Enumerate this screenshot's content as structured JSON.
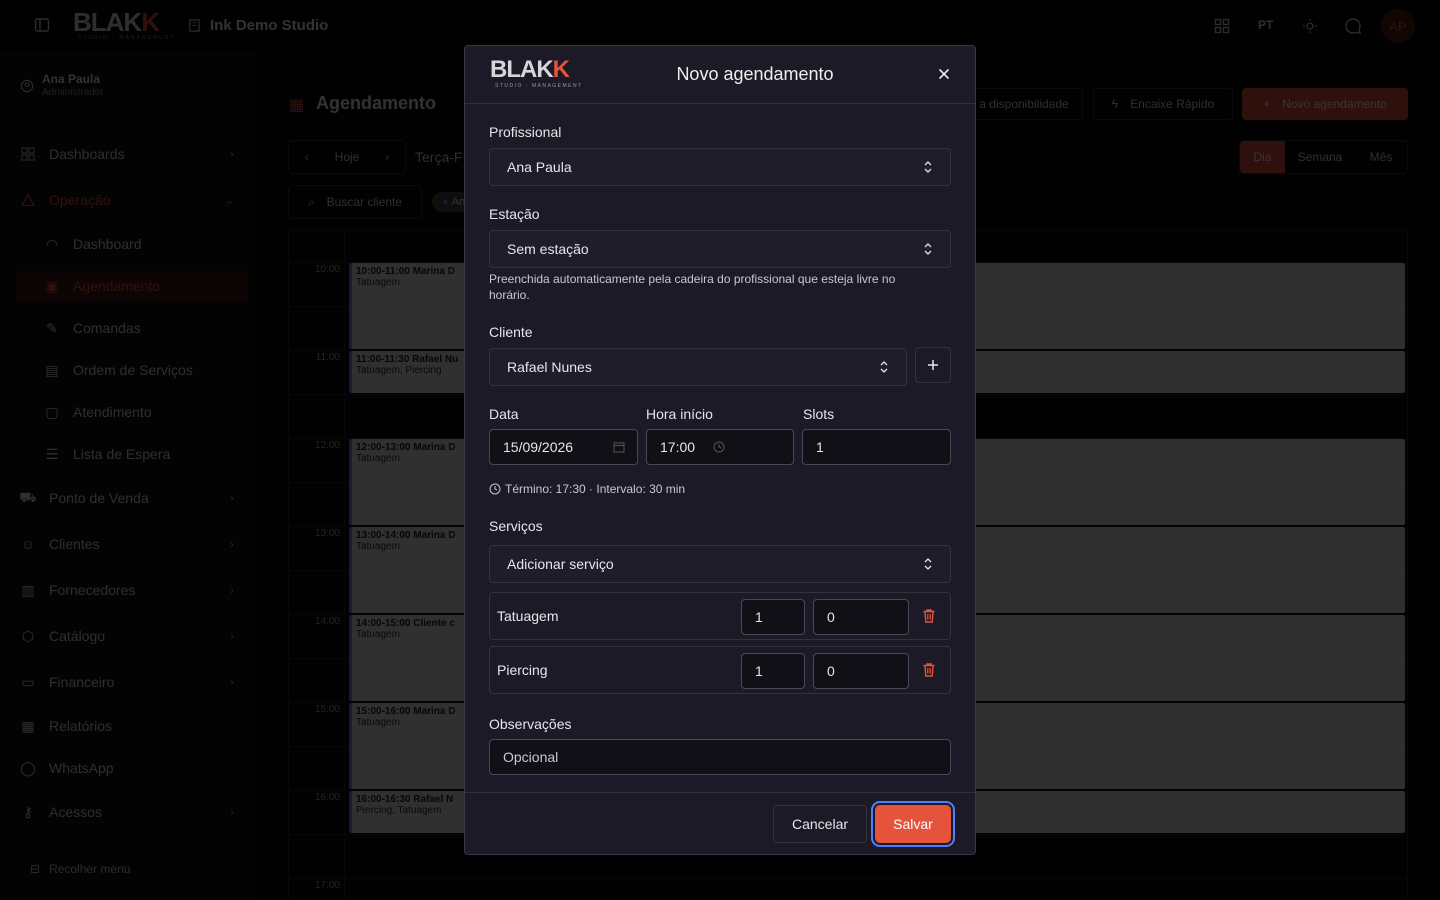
{
  "colors": {
    "accent": "#e5533d",
    "focus_ring": "#4d7fff",
    "modal_bg": "#1c1a26",
    "event_border": "#7782ff"
  },
  "topbar": {
    "logo_main": "BLAK",
    "logo_accent": "K",
    "logo_sub": "STUDIO · MANAGEMENT",
    "studio_name": "Ink Demo Studio",
    "lang": "PT",
    "avatar_initials": "AP"
  },
  "sidebar": {
    "user_name": "Ana Paula",
    "user_role": "Administrador",
    "items": [
      {
        "label": "Dashboards",
        "icon": "grid-icon"
      },
      {
        "label": "Operação",
        "icon": "triangle-icon"
      },
      {
        "label": "Ponto de Venda",
        "icon": "cart-icon"
      },
      {
        "label": "Clientes",
        "icon": "users-icon"
      },
      {
        "label": "Fornecedores",
        "icon": "building-icon"
      },
      {
        "label": "Catálogo",
        "icon": "box-icon"
      },
      {
        "label": "Financeiro",
        "icon": "wallet-icon"
      },
      {
        "label": "Relatórios",
        "icon": "chart-icon"
      },
      {
        "label": "WhatsApp",
        "icon": "chat-icon"
      },
      {
        "label": "Acessos",
        "icon": "key-icon"
      }
    ],
    "sub_items": [
      {
        "label": "Dashboard"
      },
      {
        "label": "Agendamento"
      },
      {
        "label": "Comandas"
      },
      {
        "label": "Ordem de Serviços"
      },
      {
        "label": "Atendimento"
      },
      {
        "label": "Lista de Espera"
      }
    ],
    "collapse_label": "Recolher menu"
  },
  "main": {
    "page_title": "Agendamento",
    "availability_label": "a disponibilidade",
    "quick_fit_label": "Encaixe Rápido",
    "new_appointment_label": "Novo agendamento",
    "today_label": "Hoje",
    "date_text": "Terça-F",
    "search_label": "Buscar cliente",
    "filter_chip": "An",
    "views": [
      "Dia",
      "Semana",
      "Mês"
    ],
    "times": [
      "10:00",
      "11:00",
      "12:00",
      "13:00",
      "14:00",
      "15:00",
      "16:00",
      "17:00"
    ],
    "events": [
      {
        "title": "10:00-11:00 Marina D",
        "sub": "Tatuagem"
      },
      {
        "title": "11:00-11:30 Rafael Nu",
        "sub": "Tatuagem, Piercing"
      },
      {
        "title": "12:00-13:00 Marina D",
        "sub": "Tatuagem"
      },
      {
        "title": "13:00-14:00 Marina D",
        "sub": "Tatuagem"
      },
      {
        "title": "14:00-15:00 Cliente c",
        "sub": "Tatuagem"
      },
      {
        "title": "15:00-16:00 Marina D",
        "sub": "Tatuagem"
      },
      {
        "title": "16:00-16:30 Rafael N",
        "sub": "Piercing, Tatuagem"
      }
    ]
  },
  "modal": {
    "title": "Novo agendamento",
    "professional": {
      "label": "Profissional",
      "value": "Ana Paula"
    },
    "station": {
      "label": "Estação",
      "value": "Sem estação",
      "hint": "Preenchida automaticamente pela cadeira do profissional que esteja livre no horário."
    },
    "client": {
      "label": "Cliente",
      "value": "Rafael Nunes"
    },
    "date": {
      "label": "Data",
      "value": "15/09/2026"
    },
    "start_time": {
      "label": "Hora início",
      "value": "17:00"
    },
    "slots": {
      "label": "Slots",
      "value": "1"
    },
    "info": "Término: 17:30 · Intervalo: 30 min",
    "services": {
      "label": "Serviços",
      "placeholder": "Adicionar serviço",
      "rows": [
        {
          "name": "Tatuagem",
          "qty": "1",
          "price": "0"
        },
        {
          "name": "Piercing",
          "qty": "1",
          "price": "0"
        }
      ]
    },
    "notes": {
      "label": "Observações",
      "placeholder": "Opcional"
    },
    "cancel_label": "Cancelar",
    "save_label": "Salvar"
  }
}
